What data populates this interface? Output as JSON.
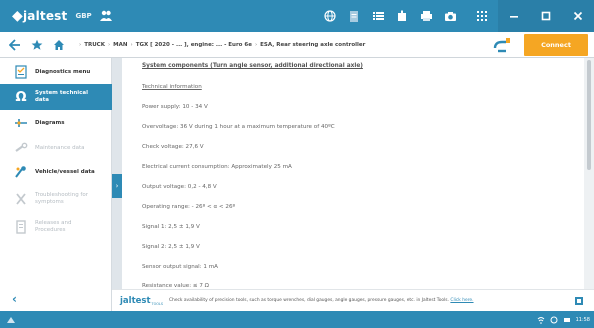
{
  "app": {
    "brand": "jaltest",
    "brand_sub": "GBP"
  },
  "toolbar": {
    "icons": [
      "globe-icon",
      "document-icon",
      "list-icon",
      "print-icon",
      "printer-icon",
      "camera-icon",
      "help-icon",
      "apps-grid-icon"
    ],
    "window_buttons": [
      "minimize-icon",
      "maximize-icon",
      "close-icon"
    ],
    "help_label": "?"
  },
  "breadcrumb": {
    "items": [
      "TRUCK",
      "MAN",
      "TGX [ 2020 - ... ], engine: ... - Euro 6e",
      "ESA, Rear steering axle controller"
    ]
  },
  "connect": {
    "label": "Connect"
  },
  "sidebar": {
    "items": [
      {
        "label": "Diagnostics menu",
        "icon": "diagnostics-icon",
        "state": "normal"
      },
      {
        "label": "System technical data",
        "icon": "omega-icon",
        "state": "active"
      },
      {
        "label": "Diagrams",
        "icon": "diagram-icon",
        "state": "normal"
      },
      {
        "label": "Maintenance data",
        "icon": "wrench-icon",
        "state": "disabled"
      },
      {
        "label": "Vehicle/vessel data",
        "icon": "vehicle-data-icon",
        "state": "normal"
      },
      {
        "label": "Troubleshooting for symptoms",
        "icon": "troubleshooting-icon",
        "state": "disabled"
      },
      {
        "label": "Releases and Procedures",
        "icon": "procedures-icon",
        "state": "disabled"
      }
    ],
    "back_icon": "back-arrow-icon"
  },
  "content": {
    "title": "System components (Turn angle sensor, additional directional axle)",
    "subtitle": "Technical information",
    "lines": [
      "Power supply: 10 - 34 V",
      "Overvoltage: 36 V during 1 hour at a maximum temperature of 40ºC",
      "Check voltage: 27,6 V",
      "Electrical current consumption: Approximately 25 mA",
      "Output voltage: 0,2 - 4,8 V",
      "Operating range: - 26º < α < 26º",
      "Signal 1: 2,5 ± 1,9 V",
      "Signal 2: 2,5 ± 1,9 V",
      "Sensor output signal: 1 mA",
      "Resistance value: ≤ 7 Ω"
    ]
  },
  "footer": {
    "logo_main": "jaltest",
    "logo_sub": "TOOLS",
    "text": "Check availability of precision tools, such as torque wrenches, dial gauges, angle gauges, pressure gauges, etc. in Jaltest Tools.",
    "link": "Click here."
  },
  "taskbar": {
    "time": "11:58"
  },
  "colors": {
    "primary": "#2e8ab5",
    "connect": "#f5a623",
    "sidebar_active": "#2e8ab5"
  }
}
